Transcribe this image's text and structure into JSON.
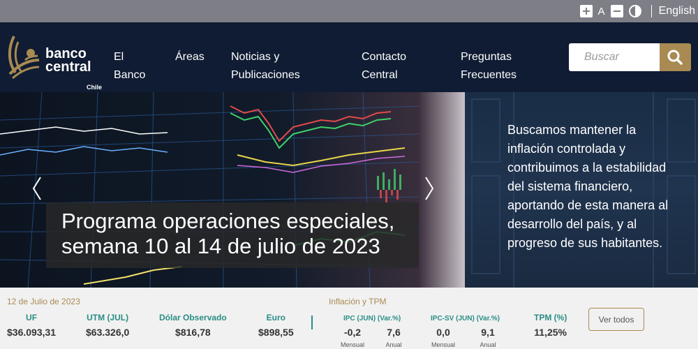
{
  "accessibility": {
    "increase_label": "+",
    "font_label": "A",
    "decrease_label": "-",
    "language": "English"
  },
  "logo": {
    "line1": "banco",
    "line2": "central",
    "line3": "Chile"
  },
  "nav": {
    "items": [
      {
        "line1": "El",
        "line2": "Banco"
      },
      {
        "line1": "Áreas",
        "line2": ""
      },
      {
        "line1": "Noticias y",
        "line2": "Publicaciones"
      },
      {
        "line1": "Contacto",
        "line2": "Central"
      },
      {
        "line1": "Preguntas",
        "line2": "Frecuentes"
      }
    ]
  },
  "search": {
    "placeholder": "Buscar"
  },
  "hero": {
    "caption_line1": "Programa operaciones especiales,",
    "caption_line2": "semana 10 al 14 de julio de 2023",
    "tagline": "Buscamos mantener la inflación controlada y contribuimos a la estabilidad del sistema financiero, aportando de esta manera al desarrollo del país, y al progreso de sus habitantes."
  },
  "indicators": {
    "date": "12 de Julio de 2023",
    "inflation_title": "Inflación y TPM",
    "items": [
      {
        "label": "UF",
        "value": "$36.093,31"
      },
      {
        "label": "UTM (JUL)",
        "value": "$63.326,0"
      },
      {
        "label": "Dólar Observado",
        "value": "$816,78"
      },
      {
        "label": "Euro",
        "value": "$898,55"
      }
    ],
    "ipc": {
      "label": "IPC (JUN)",
      "var": "(Var.%)",
      "monthly": "-0,2",
      "annual": "7,6",
      "monthly_label": "Mensual",
      "annual_label": "Anual"
    },
    "ipcsv": {
      "label": "IPC-SV (JUN)",
      "var": "(Var.%)",
      "monthly": "0,0",
      "annual": "9,1",
      "monthly_label": "Mensual",
      "annual_label": "Anual"
    },
    "tpm": {
      "label": "TPM (%)",
      "value": "11,25%"
    },
    "see_all": "Ver todos"
  },
  "colors": {
    "navbar": "#0f1c33",
    "accent_gold": "#a88a52",
    "teal": "#2a8d86",
    "topbar": "#7d7e86"
  }
}
